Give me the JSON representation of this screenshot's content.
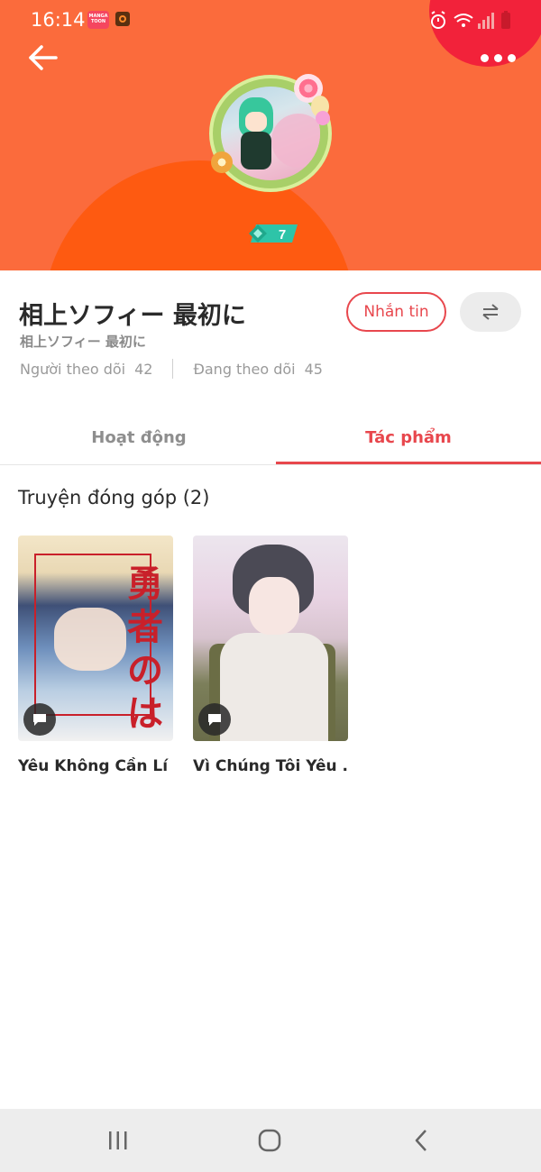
{
  "status_bar": {
    "time": "16:14",
    "app_badge": "MANGA TOON"
  },
  "header": {
    "level": "7"
  },
  "profile": {
    "name": "相上ソフィー 最初に",
    "subtitle": "相上ソフィー 最初に",
    "followers_label": "Người theo dõi",
    "followers_count": "42",
    "following_label": "Đang theo dõi",
    "following_count": "45",
    "message_button": "Nhắn tin"
  },
  "tabs": [
    {
      "label": "Hoạt động",
      "active": false
    },
    {
      "label": "Tác phẩm",
      "active": true
    }
  ],
  "section": {
    "title": "Truyện đóng góp (2)"
  },
  "works": [
    {
      "title": "Yêu Không Cần Lí ...",
      "cover_text": "勇者のはるみ"
    },
    {
      "title": "Vì Chúng Tôi Yêu ..."
    }
  ],
  "colors": {
    "header_bg": "#fb6b3c",
    "header_arc": "#fe5a11",
    "accent": "#e8474d",
    "nav_bg": "#ededed"
  },
  "icons": {
    "back": "arrow-left-icon",
    "more": "more-dots-icon",
    "swap": "swap-arrows-icon",
    "chat": "chat-bubble-icon"
  }
}
